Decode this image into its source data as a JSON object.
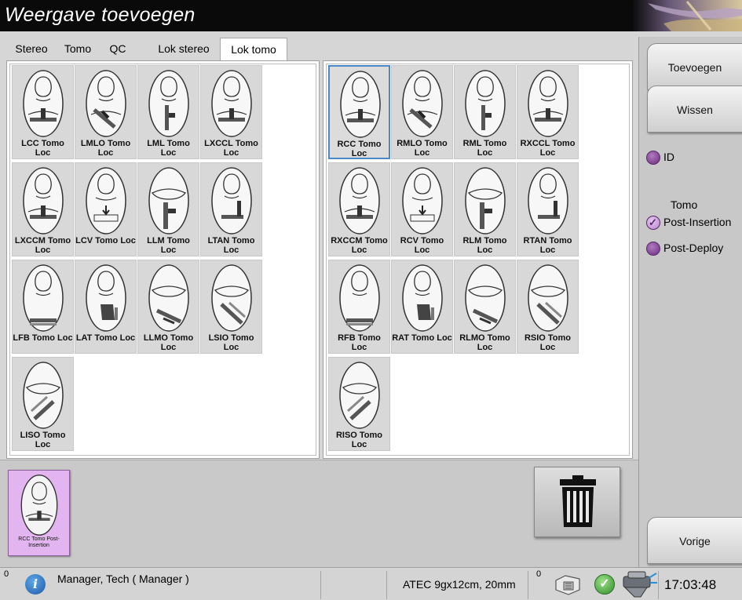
{
  "window": {
    "title": "Weergave toevoegen"
  },
  "tabs": [
    {
      "label": "Stereo",
      "active": false
    },
    {
      "label": "Tomo",
      "active": false
    },
    {
      "label": "QC",
      "active": false
    },
    {
      "label": "Lok stereo",
      "active": false
    },
    {
      "label": "Lok tomo",
      "active": true
    }
  ],
  "views": {
    "left": [
      {
        "label": "LCC Tomo Loc",
        "pose": "cc"
      },
      {
        "label": "LMLO Tomo Loc",
        "pose": "mlo"
      },
      {
        "label": "LML Tomo Loc",
        "pose": "ml"
      },
      {
        "label": "LXCCL Tomo Loc",
        "pose": "cc"
      },
      {
        "label": "LXCCM Tomo Loc",
        "pose": "cc"
      },
      {
        "label": "LCV Tomo Loc",
        "pose": "cv"
      },
      {
        "label": "LLM Tomo Loc",
        "pose": "lm"
      },
      {
        "label": "LTAN Tomo Loc",
        "pose": "tan"
      },
      {
        "label": "LFB Tomo Loc",
        "pose": "fb"
      },
      {
        "label": "LAT Tomo Loc",
        "pose": "lat"
      },
      {
        "label": "LLMO Tomo Loc",
        "pose": "lmo"
      },
      {
        "label": "LSIO Tomo Loc",
        "pose": "sio"
      },
      {
        "label": "LISO Tomo Loc",
        "pose": "iso"
      }
    ],
    "right": [
      {
        "label": "RCC Tomo Loc",
        "pose": "cc",
        "selected": true
      },
      {
        "label": "RMLO Tomo Loc",
        "pose": "mlo"
      },
      {
        "label": "RML Tomo Loc",
        "pose": "ml"
      },
      {
        "label": "RXCCL Tomo Loc",
        "pose": "cc"
      },
      {
        "label": "RXCCM Tomo Loc",
        "pose": "cc"
      },
      {
        "label": "RCV Tomo Loc",
        "pose": "cv"
      },
      {
        "label": "RLM Tomo Loc",
        "pose": "lm"
      },
      {
        "label": "RTAN Tomo Loc",
        "pose": "tan"
      },
      {
        "label": "RFB Tomo Loc",
        "pose": "fb"
      },
      {
        "label": "RAT Tomo Loc",
        "pose": "lat"
      },
      {
        "label": "RLMO Tomo Loc",
        "pose": "lmo"
      },
      {
        "label": "RSIO Tomo Loc",
        "pose": "sio"
      },
      {
        "label": "RISO Tomo Loc",
        "pose": "iso"
      }
    ]
  },
  "sidebar": {
    "add_label": "Toevoegen",
    "clear_label": "Wissen",
    "id_option": {
      "label": "ID",
      "checked": false
    },
    "tomo_group_label": "Tomo",
    "post_insertion": {
      "label": "Post-Insertion",
      "checked": true
    },
    "post_deploy": {
      "label": "Post-Deploy",
      "checked": false
    },
    "back_label": "Vorige"
  },
  "acquired": {
    "label": "RCC Tomo Post-Insertion"
  },
  "trash_icon": "trash-icon",
  "status": {
    "count_left": "0",
    "user": "Manager, Tech ( Manager )",
    "detector": "ATEC 9gx12cm, 20mm",
    "count_right": "0",
    "time": "17:03:48"
  },
  "colors": {
    "selected_border": "#4a88c7",
    "radio_purple": "#7a3a8e",
    "acquired_bg": "#e2b4f0"
  }
}
